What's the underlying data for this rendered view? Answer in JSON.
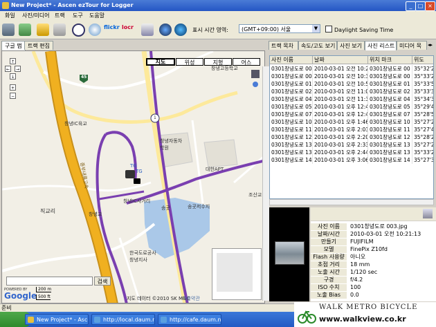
{
  "window": {
    "title": "New Project* - Ascen ezTour for Logger"
  },
  "menu": [
    "화일",
    "사진/미디어",
    "트랙",
    "도구",
    "도움말"
  ],
  "toolbar": {
    "timezone_label": "표시 시간 영역:",
    "timezone_value": "(GMT+09:00) 서울",
    "dst_label": "Daylight Saving Time",
    "icons": [
      "new-icon",
      "import-icon",
      "open-folder-icon",
      "save-icon",
      "clock-icon",
      "compass-icon",
      "globe-icon",
      "flickr-icon",
      "locr-icon",
      "export-icon",
      "google-earth-icon",
      "earth-icon"
    ],
    "flickr_text": "flickr",
    "locr_text": "locr"
  },
  "left_tabs": [
    "구글 맵",
    "트랙 편집"
  ],
  "map": {
    "types": [
      "지도",
      "위성",
      "지형",
      "어스"
    ],
    "search_button": "검색",
    "google": "Google",
    "powered_by": "POWERED BY",
    "scale_m": "200 m",
    "scale_ft": "500 ft",
    "copyright": "지도 데이터 ©2010 SK M&C",
    "terms": "이용약관",
    "route_45": "45",
    "route_1": "1",
    "labels": [
      {
        "text": "창녕IC육교"
      },
      {
        "text": "창녕자동차\n학원"
      },
      {
        "text": "창녕IC사거리"
      },
      {
        "text": "창녕교"
      },
      {
        "text": "송곳"
      },
      {
        "text": "송곳저수지"
      },
      {
        "text": "직교리"
      },
      {
        "text": "한국도로공사\n창녕지사"
      },
      {
        "text": "대한APT"
      },
      {
        "text": "조산교"
      },
      {
        "text": "창녕고등학교"
      },
      {
        "text": "중부내륙고속"
      },
      {
        "text": "TG"
      },
      {
        "text": "TG"
      }
    ]
  },
  "right_tabs": [
    "트랙 목차",
    "속도/고도 보기",
    "사진 보기",
    "사진 리스트",
    "미디어 목"
  ],
  "photo_list": {
    "columns": [
      "사진 이름",
      "날짜",
      "위치 마크",
      "위도"
    ],
    "rows": [
      [
        "0301창녕도로 00",
        "2010-03-01 오전 10:2",
        "0301창녕도로 00",
        "35°32'24"
      ],
      [
        "0301창녕도로 00",
        "2010-03-01 오전 10:3",
        "0301창녕도로 00",
        "35°33'24"
      ],
      [
        "0301창녕도로 01",
        "2010-03-01 오전 10:5",
        "0301창녕도로 01",
        "35°33'50"
      ],
      [
        "0301창녕도로 02",
        "2010-03-01 오전 11:0",
        "0301창녕도로 02",
        "35°33'32"
      ],
      [
        "0301창녕도로 04",
        "2010-03-01 오전 11:3",
        "0301창녕도로 04",
        "35°34'30"
      ],
      [
        "0301창녕도로 05",
        "2010-03-01 오후 12:4",
        "0301창녕도로 05",
        "35°29'46"
      ],
      [
        "0301창녕도로 07",
        "2010-03-01 오후 12:4",
        "0301창녕도로 07",
        "35°28'51"
      ],
      [
        "0301창녕도로 10",
        "2010-03-01 오후 1:46",
        "0301창녕도로 10",
        "35°27'24"
      ],
      [
        "0301창녕도로 11",
        "2010-03-01 오후 2:03",
        "0301창녕도로 11",
        "35°27'41"
      ],
      [
        "0301창녕도로 12",
        "2010-03-01 오후 2:20",
        "0301창녕도로 12",
        "35°28'29"
      ],
      [
        "0301창녕도로 13",
        "2010-03-01 오후 2:33",
        "0301창녕도로 13",
        "35°27'22"
      ],
      [
        "0301창녕도로 13",
        "2010-03-01 오후 2:44",
        "0301창녕도로 13",
        "35°33'24"
      ],
      [
        "0301창녕도로 14",
        "2010-03-01 오후 3:06",
        "0301창녕도로 14",
        "35°27'30"
      ]
    ]
  },
  "properties": [
    [
      "사진 이름",
      "0301창녕도로 003.jpg"
    ],
    [
      "날짜/시간",
      "2010-03-01 오전 10:21:13"
    ],
    [
      "만들기",
      "FUJIFILM"
    ],
    [
      "모델",
      "FinePix Z10fd"
    ],
    [
      "Flash 사용량",
      "아니오"
    ],
    [
      "초점 거리",
      "18 mm"
    ],
    [
      "노출 시간",
      "1/120 sec"
    ],
    [
      "구경",
      "f/4.2"
    ],
    [
      "ISO 수치",
      "100"
    ],
    [
      "노출 Bias",
      "0.0"
    ]
  ],
  "status": {
    "text": "준비"
  },
  "taskbar": {
    "items": [
      "New Project* - Ascen ...",
      "http://local.daum.net - ...",
      "http://cafe.daum.net - ..."
    ]
  },
  "watermark": {
    "top": "WALK METRO BICYCLE",
    "url": "www.walkview.co.kr"
  },
  "colors": {
    "track": "#7a3fb0",
    "highway": "#f0b020",
    "title_bar": "#2456c4",
    "water": "#aac8e8"
  }
}
